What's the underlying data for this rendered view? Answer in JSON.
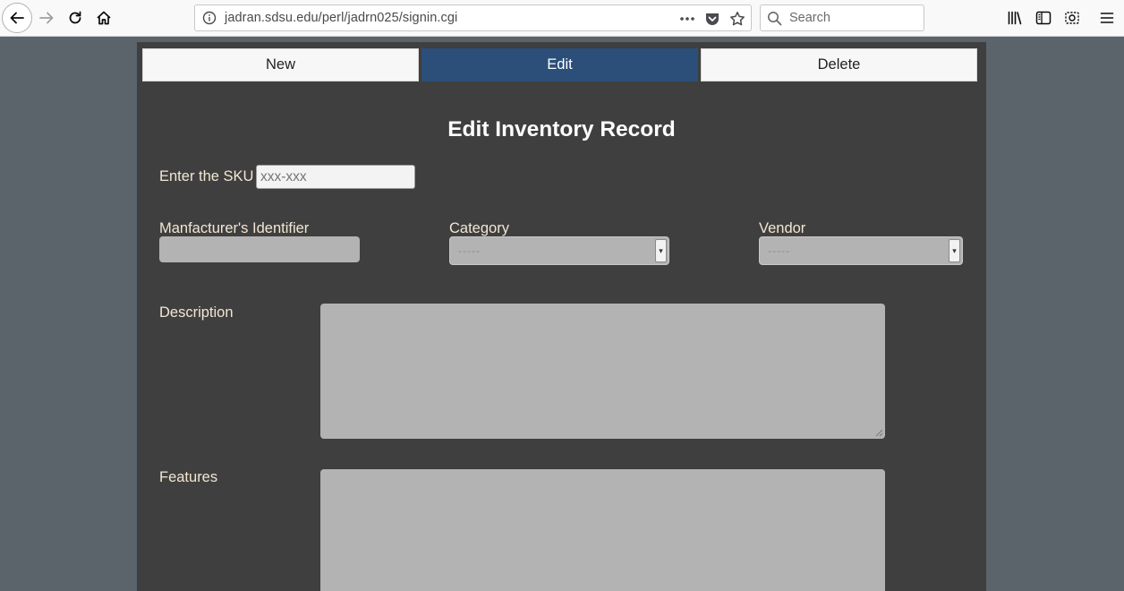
{
  "browser": {
    "url": "jadran.sdsu.edu/perl/jadrn025/signin.cgi",
    "search_placeholder": "Search",
    "icons": [
      "back-icon",
      "forward-icon",
      "reload-icon",
      "home-icon",
      "site-info-icon",
      "page-actions-icon",
      "pocket-icon",
      "bookmark-star-icon",
      "search-icon",
      "library-icon",
      "sidebar-icon",
      "screenshot-icon",
      "menu-icon"
    ]
  },
  "tabs": [
    {
      "label": "New",
      "active": false
    },
    {
      "label": "Edit",
      "active": true
    },
    {
      "label": "Delete",
      "active": false
    }
  ],
  "form": {
    "title": "Edit Inventory Record",
    "sku_label": "Enter the SKU",
    "sku_placeholder": "xxx-xxx",
    "manufacturer_label": "Manfacturer's Identifier",
    "category_label": "Category",
    "category_value": "-----",
    "vendor_label": "Vendor",
    "vendor_value": "-----",
    "description_label": "Description",
    "features_label": "Features"
  },
  "colors": {
    "page_bg": "#5b636b",
    "panel_bg": "#3f3f3f",
    "active_tab": "#2c4f7a",
    "label_text": "#f2e6d3",
    "field_bg": "#b3b3b3"
  }
}
